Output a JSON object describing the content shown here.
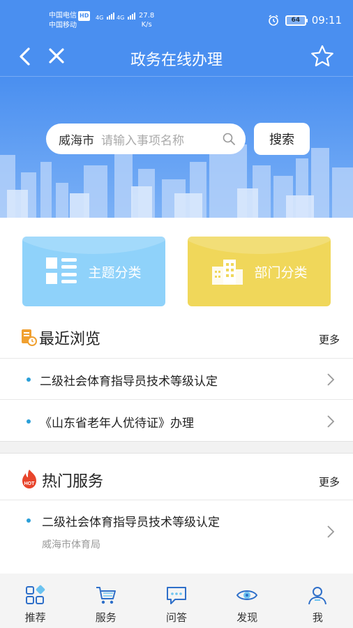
{
  "status_bar": {
    "carrier1": "中国电信",
    "hd": "HD",
    "carrier2": "中国移动",
    "net1": "4G",
    "net2": "4G",
    "speed": "27.8",
    "speed_unit": "K/s",
    "battery": "64",
    "time": "09:11",
    "icons": [
      "alarm-icon",
      "battery-icon"
    ]
  },
  "nav": {
    "title": "政务在线办理",
    "icons": [
      "back-icon",
      "close-icon",
      "star-icon"
    ]
  },
  "search": {
    "city": "威海市",
    "placeholder": "请输入事项名称",
    "button": "搜索"
  },
  "categories": [
    {
      "label": "主题分类",
      "icon": "list-grid-icon",
      "color": "#8fd2fa"
    },
    {
      "label": "部门分类",
      "icon": "building-icon",
      "color": "#f0d75a"
    }
  ],
  "recent": {
    "title": "最近浏览",
    "more": "更多",
    "items": [
      {
        "text": "二级社会体育指导员技术等级认定"
      },
      {
        "text": "《山东省老年人优待证》办理"
      }
    ]
  },
  "hot": {
    "title": "热门服务",
    "more": "更多",
    "badge": "HOT",
    "items": [
      {
        "text": "二级社会体育指导员技术等级认定",
        "sub": "威海市体育局"
      }
    ]
  },
  "tabs": [
    {
      "label": "推荐",
      "icon": "recommend-icon"
    },
    {
      "label": "服务",
      "icon": "cart-icon"
    },
    {
      "label": "问答",
      "icon": "chat-icon"
    },
    {
      "label": "发现",
      "icon": "eye-icon"
    },
    {
      "label": "我",
      "icon": "user-icon"
    }
  ],
  "colors": {
    "primary": "#4a8ff0",
    "theme_card": "#8fd2fa",
    "dept_card": "#f0d75a",
    "dot": "#2a9fd8",
    "hot_red": "#e8452c",
    "recent_orange": "#f0a030"
  }
}
